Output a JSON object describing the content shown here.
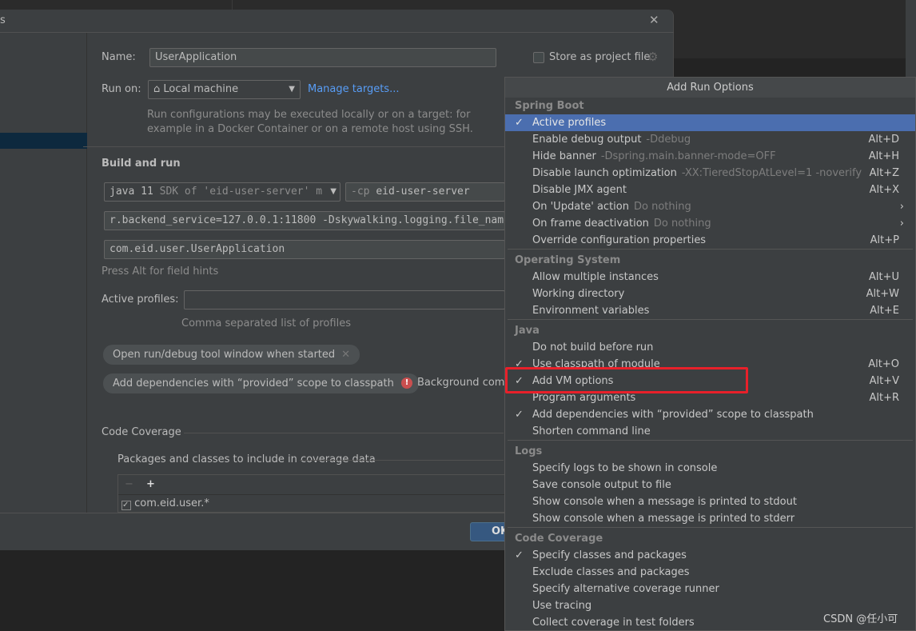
{
  "dialog": {
    "title_fragment": "s",
    "close": "✕"
  },
  "form": {
    "name_label": "Name:",
    "name_value": "UserApplication",
    "store_label": "Store as project file",
    "run_on_label": "Run on:",
    "run_on_value": "Local machine",
    "manage_targets": "Manage targets...",
    "run_on_hint1": "Run configurations may be executed locally or on a target: for",
    "run_on_hint2": "example in a Docker Container or on a remote host using SSH.",
    "build_and_run": "Build and run",
    "jdk": "java 11",
    "jdk_hint": "SDK of 'eid-user-server' m",
    "cp_prefix": "-cp",
    "cp_value": "eid-user-server",
    "vm_options": "r.backend_service=127.0.0.1:11800 -Dskywalking.logging.file_name",
    "main_class": "com.eid.user.UserApplication",
    "field_hint": "Press Alt for field hints",
    "active_profiles_label": "Active profiles:",
    "active_profiles_value": "",
    "profiles_hint": "Comma separated list of profiles",
    "chip1": "Open run/debug tool window when started",
    "chip2": "Add dependencies with “provided” scope to classpath",
    "error_text": "Background comp",
    "code_coverage": "Code Coverage",
    "packages_label": "Packages and classes to include in coverage data",
    "coverage_row": "com.eid.user.*",
    "ok": "OK"
  },
  "popup": {
    "title": "Add Run Options",
    "groups": [
      {
        "name": "Spring Boot",
        "items": [
          {
            "label": "Active profiles",
            "checked": true,
            "active": true
          },
          {
            "label": "Enable debug output",
            "hint": "-Ddebug",
            "shortcut": "Alt+D"
          },
          {
            "label": "Hide banner",
            "hint": "-Dspring.main.banner-mode=OFF",
            "shortcut": "Alt+H"
          },
          {
            "label": "Disable launch optimization",
            "hint": "-XX:TieredStopAtLevel=1 -noverify",
            "shortcut": "Alt+Z"
          },
          {
            "label": "Disable JMX agent",
            "shortcut": "Alt+X"
          },
          {
            "label": "On 'Update' action",
            "hint": "Do nothing",
            "submenu": true
          },
          {
            "label": "On frame deactivation",
            "hint": "Do nothing",
            "submenu": true
          },
          {
            "label": "Override configuration properties",
            "shortcut": "Alt+P"
          }
        ]
      },
      {
        "name": "Operating System",
        "items": [
          {
            "label": "Allow multiple instances",
            "shortcut": "Alt+U"
          },
          {
            "label": "Working directory",
            "shortcut": "Alt+W"
          },
          {
            "label": "Environment variables",
            "shortcut": "Alt+E"
          }
        ]
      },
      {
        "name": "Java",
        "items": [
          {
            "label": "Do not build before run"
          },
          {
            "label": "Use classpath of module",
            "checked": true,
            "shortcut": "Alt+O"
          },
          {
            "label": "Add VM options",
            "checked": true,
            "shortcut": "Alt+V",
            "highlighted": true
          },
          {
            "label": "Program arguments",
            "shortcut": "Alt+R"
          },
          {
            "label": "Add dependencies with “provided” scope to classpath",
            "checked": true
          },
          {
            "label": "Shorten command line"
          }
        ]
      },
      {
        "name": "Logs",
        "items": [
          {
            "label": "Specify logs to be shown in console"
          },
          {
            "label": "Save console output to file"
          },
          {
            "label": "Show console when a message is printed to stdout"
          },
          {
            "label": "Show console when a message is printed to stderr"
          }
        ]
      },
      {
        "name": "Code Coverage",
        "items": [
          {
            "label": "Specify classes and packages",
            "checked": true
          },
          {
            "label": "Exclude classes and packages"
          },
          {
            "label": "Specify alternative coverage runner"
          },
          {
            "label": "Use tracing"
          },
          {
            "label": "Collect coverage in test folders"
          }
        ]
      }
    ]
  },
  "watermark": "CSDN @任小可",
  "colors": {
    "selection": "#4b6eaf",
    "link": "#589df6",
    "highlight_box": "#e8202a",
    "ok_button": "#365880"
  }
}
